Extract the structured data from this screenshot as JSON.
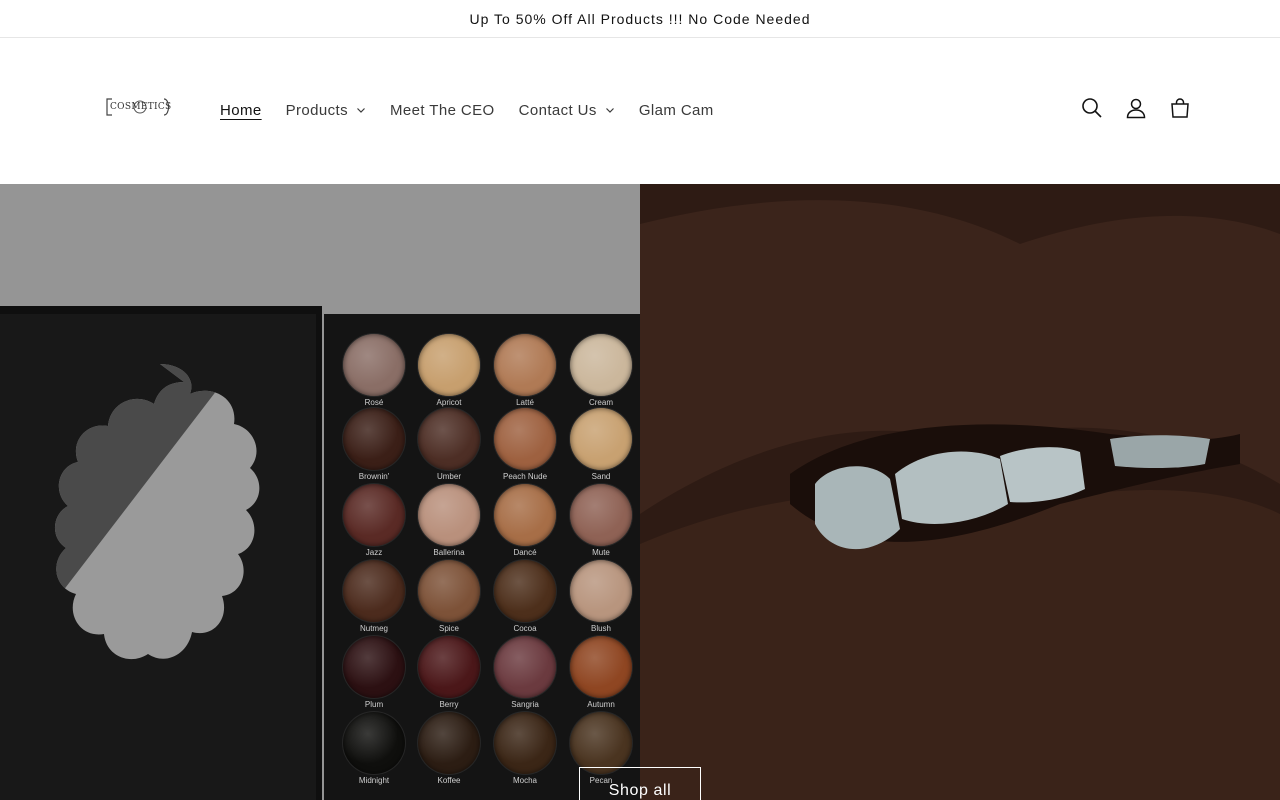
{
  "announcement": {
    "text": "Up To 50% Off All Products !!! No Code Needed"
  },
  "header": {
    "logo_text": "COSMETICS",
    "nav": [
      {
        "label": "Home",
        "active": true,
        "dropdown": false
      },
      {
        "label": "Products",
        "active": false,
        "dropdown": true
      },
      {
        "label": "Meet The CEO",
        "active": false,
        "dropdown": false
      },
      {
        "label": "Contact Us",
        "active": false,
        "dropdown": true
      },
      {
        "label": "Glam Cam",
        "active": false,
        "dropdown": false
      }
    ],
    "icons": [
      "search-icon",
      "account-icon",
      "cart-icon"
    ]
  },
  "hero": {
    "shop_all_label": "Shop all",
    "palette_shades": [
      [
        "Rosé",
        "Apricot",
        "Latté",
        "Cream"
      ],
      [
        "Brownin'",
        "Umber",
        "Peach Nude",
        "Sand"
      ],
      [
        "Jazz",
        "Ballerina",
        "Dancé",
        "Mute"
      ],
      [
        "Nutmeg",
        "Spice",
        "Cocoa",
        "Blush"
      ],
      [
        "Plum",
        "Berry",
        "Sangria",
        "Autumn"
      ],
      [
        "Midnight",
        "Koffee",
        "Mocha",
        "Pecan"
      ]
    ]
  },
  "colors": {
    "text": "#121212",
    "hero_left_bg": "#959595",
    "lip": "#3a241c",
    "shades": [
      [
        "#8a6e66",
        "#c79f6e",
        "#b07a55",
        "#cbb79c"
      ],
      [
        "#3b1f17",
        "#4d2e25",
        "#9e6140",
        "#c8a171"
      ],
      [
        "#5a2a25",
        "#b9907c",
        "#a76e47",
        "#8f6255"
      ],
      [
        "#4c2b1d",
        "#7d5238",
        "#4d2f1b",
        "#b8957e"
      ],
      [
        "#2c1012",
        "#4b1719",
        "#6b3a3f",
        "#8f4622"
      ],
      [
        "#0f0f0d",
        "#2c1d13",
        "#3b2616",
        "#4a3420"
      ]
    ]
  }
}
